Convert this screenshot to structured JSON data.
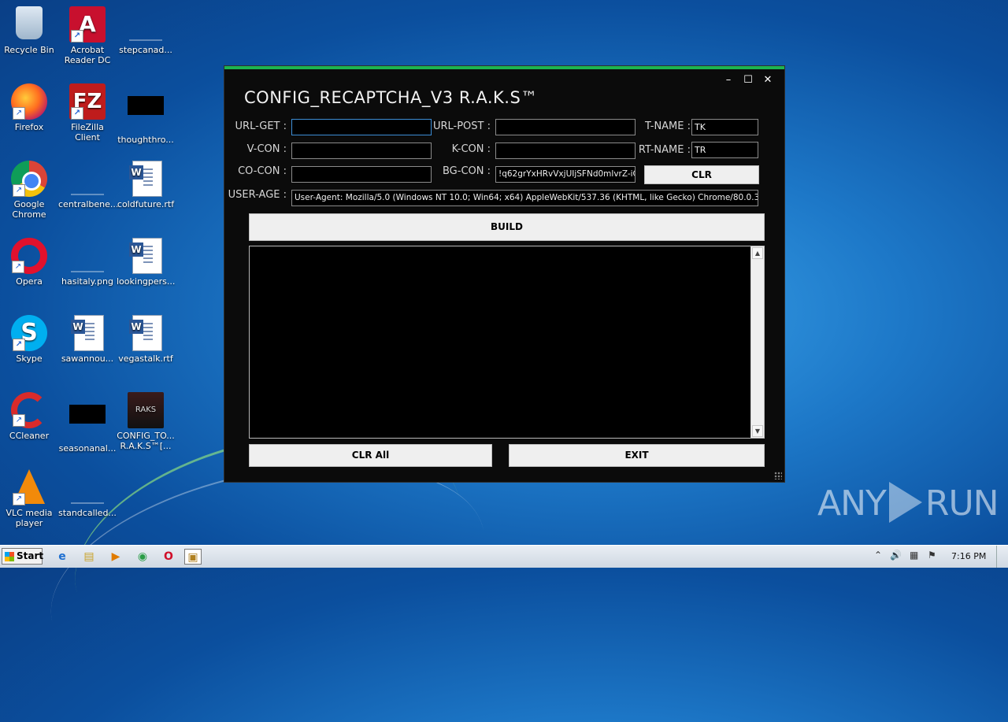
{
  "desktop": {
    "icons": [
      {
        "label": "Recycle Bin"
      },
      {
        "label": "Acrobat Reader DC"
      },
      {
        "label": "stepcanad..."
      },
      {
        "label": "Firefox"
      },
      {
        "label": "FileZilla Client"
      },
      {
        "label": "thoughthro..."
      },
      {
        "label": "Google Chrome"
      },
      {
        "label": "centralbene..."
      },
      {
        "label": "coldfuture.rtf"
      },
      {
        "label": "Opera"
      },
      {
        "label": "hasitaly.png"
      },
      {
        "label": "lookingpers..."
      },
      {
        "label": "Skype"
      },
      {
        "label": "sawannou..."
      },
      {
        "label": "vegastalk.rtf"
      },
      {
        "label": "CCleaner"
      },
      {
        "label": "seasonanal..."
      },
      {
        "label": "CONFIG_TO... R.A.K.S™[..."
      },
      {
        "label": "VLC media player"
      },
      {
        "label": "standcalled..."
      }
    ],
    "glyphs": {
      "acrobat": "A",
      "filezilla": "FZ",
      "skype": "S",
      "word": "W",
      "game": "RAKS",
      "shortcut": "↗"
    }
  },
  "window": {
    "title": "CONFIG_RECAPTCHA_V3 R.A.K.S™",
    "controls": {
      "minimize": "–",
      "maximize": "☐",
      "close": "✕"
    },
    "labels": {
      "url_get": "URL-GET :",
      "url_post": "URL-POST :",
      "t_name": "T-NAME :",
      "v_con": "V-CON :",
      "k_con": "K-CON :",
      "rt_name": "RT-NAME :",
      "co_con": "CO-CON :",
      "bg_con": "BG-CON :",
      "user_age": "USER-AGE :"
    },
    "fields": {
      "url_get": "",
      "url_post": "",
      "t_name": "TK",
      "v_con": "",
      "k_con": "",
      "rt_name": "TR",
      "co_con": "",
      "bg_con": "!q62grYxHRvVxjUIjSFNd0mlvrZ-iC",
      "user_age": "User-Agent: Mozilla/5.0 (Windows NT 10.0; Win64; x64) AppleWebKit/537.36 (KHTML, like Gecko) Chrome/80.0.3"
    },
    "buttons": {
      "clr": "CLR",
      "build": "BUILD",
      "clr_all": "CLR All",
      "exit": "EXIT"
    },
    "scroll": {
      "up": "▲",
      "down": "▼"
    }
  },
  "watermark": {
    "left": "ANY",
    "right": "RUN"
  },
  "taskbar": {
    "start": "Start",
    "apps": {
      "ie": "e",
      "explorer": "▤",
      "media": "▶",
      "chrome": "◉",
      "opera": "O",
      "app": "▣"
    },
    "tray": {
      "expand": "⌃",
      "volume": "🔊",
      "network": "▦",
      "flag": "⚑"
    },
    "clock": "7:16 PM"
  }
}
